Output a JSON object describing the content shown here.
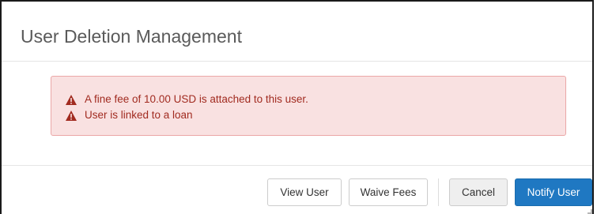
{
  "dialog": {
    "title": "User Deletion Management"
  },
  "alert": {
    "icon": "warning-icon",
    "color": "#a12b20",
    "background": "#f9e1e1",
    "messages": [
      "A fine fee of 10.00 USD is attached to this user.",
      "User is linked to a loan"
    ]
  },
  "footer": {
    "view_user_label": "View User",
    "waive_fees_label": "Waive Fees",
    "cancel_label": "Cancel",
    "notify_user_label": "Notify User",
    "primary_color": "#1f78c2"
  }
}
